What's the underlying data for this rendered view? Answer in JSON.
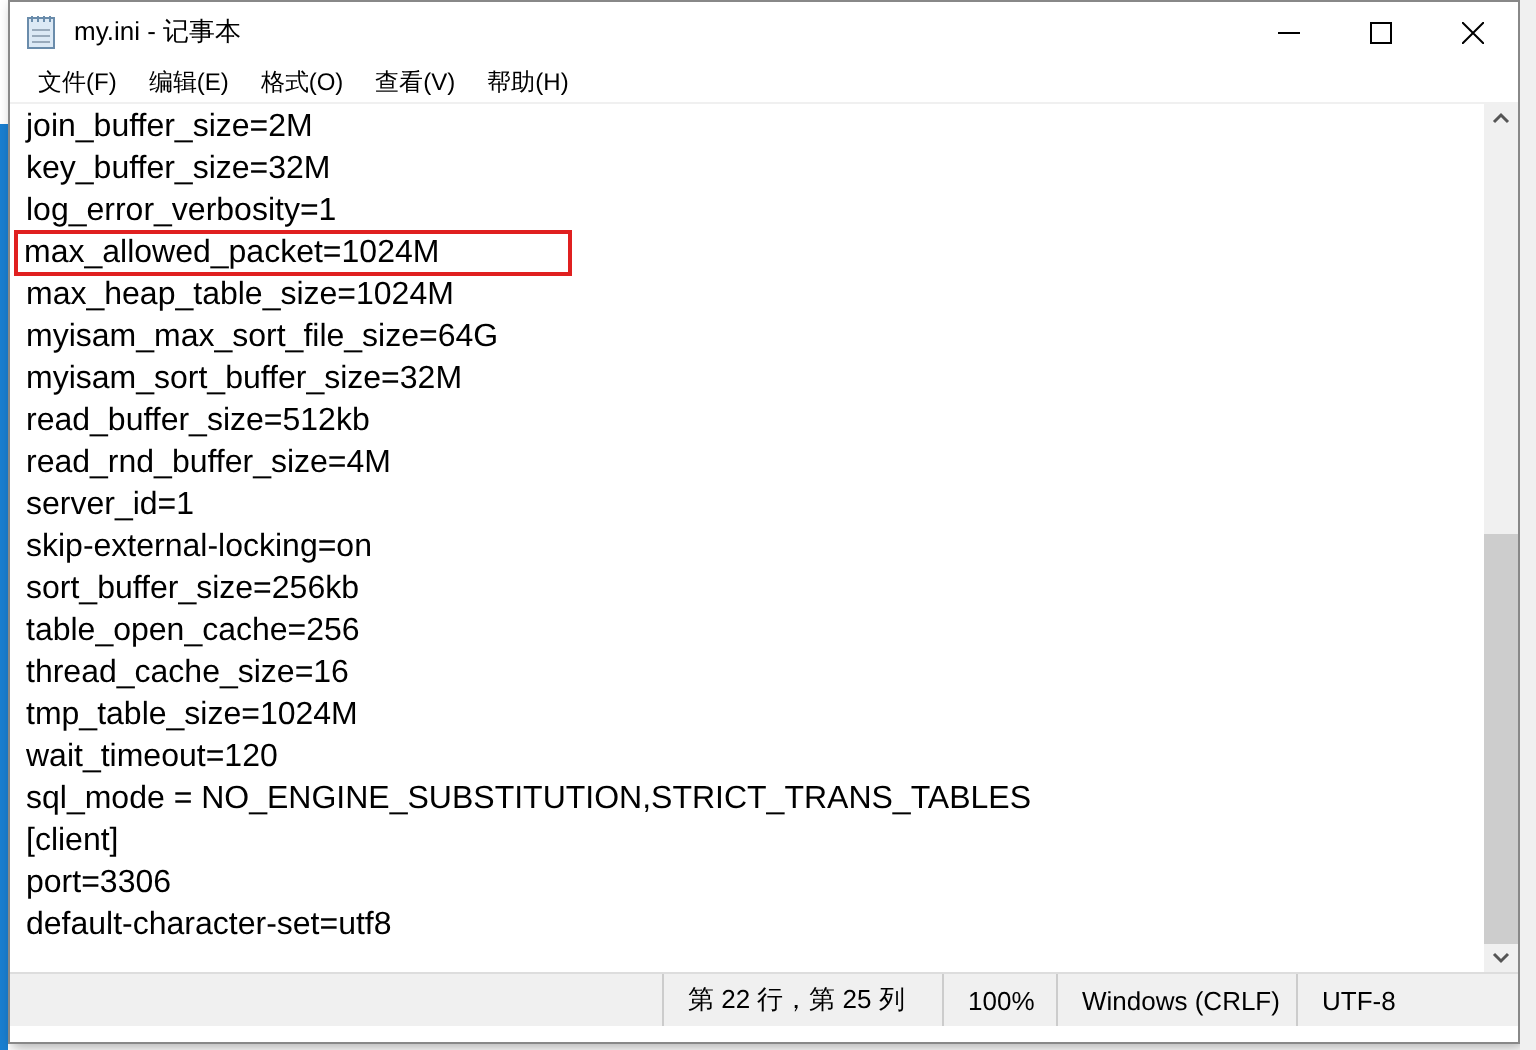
{
  "window": {
    "title": "my.ini - 记事本"
  },
  "menu": [
    "文件(F)",
    "编辑(E)",
    "格式(O)",
    "查看(V)",
    "帮助(H)"
  ],
  "editor": {
    "lines": [
      {
        "text": "join_buffer_size=2M",
        "highlighted": false
      },
      {
        "text": "key_buffer_size=32M",
        "highlighted": false
      },
      {
        "text": "log_error_verbosity=1",
        "highlighted": false
      },
      {
        "text": "max_allowed_packet=1024M",
        "highlighted": true
      },
      {
        "text": "max_heap_table_size=1024M",
        "highlighted": false
      },
      {
        "text": "myisam_max_sort_file_size=64G",
        "highlighted": false
      },
      {
        "text": "myisam_sort_buffer_size=32M",
        "highlighted": false
      },
      {
        "text": "read_buffer_size=512kb",
        "highlighted": false
      },
      {
        "text": "read_rnd_buffer_size=4M",
        "highlighted": false
      },
      {
        "text": "server_id=1",
        "highlighted": false
      },
      {
        "text": "skip-external-locking=on",
        "highlighted": false
      },
      {
        "text": "sort_buffer_size=256kb",
        "highlighted": false
      },
      {
        "text": "table_open_cache=256",
        "highlighted": false
      },
      {
        "text": "thread_cache_size=16",
        "highlighted": false
      },
      {
        "text": "tmp_table_size=1024M",
        "highlighted": false
      },
      {
        "text": "wait_timeout=120",
        "highlighted": false
      },
      {
        "text": "sql_mode = NO_ENGINE_SUBSTITUTION,STRICT_TRANS_TABLES",
        "highlighted": false
      },
      {
        "text": "[client]",
        "highlighted": false
      },
      {
        "text": "port=3306",
        "highlighted": false
      },
      {
        "text": "default-character-set=utf8",
        "highlighted": false
      }
    ]
  },
  "status_bar": {
    "position": "第 22 行，第 25 列",
    "zoom": "100%",
    "line_ending": "Windows (CRLF)",
    "encoding": "UTF-8"
  }
}
